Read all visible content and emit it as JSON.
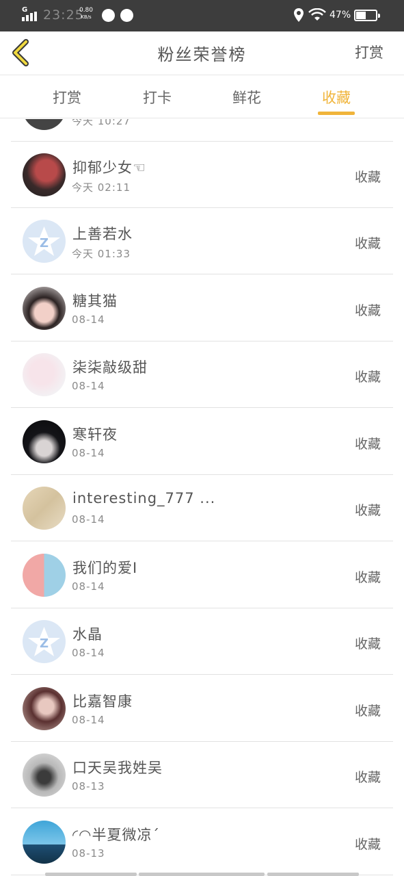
{
  "status_bar": {
    "network": "G",
    "time": "23:25",
    "speed_value": "0.80",
    "speed_unit": "KB/s",
    "battery": "47%",
    "battery_level": 0.47
  },
  "header": {
    "back_icon": "chevron-left-icon",
    "title": "粉丝荣誉榜",
    "right_action": "打赏"
  },
  "tabs": [
    {
      "label": "打赏",
      "active": false
    },
    {
      "label": "打卡",
      "active": false
    },
    {
      "label": "鲜花",
      "active": false
    },
    {
      "label": "收藏",
      "active": true
    }
  ],
  "accent_color": "#f0b43a",
  "list": {
    "partial_top_time": "今天 10:27",
    "items": [
      {
        "name": "抑郁少女☜",
        "time": "今天 02:11",
        "action": "收藏"
      },
      {
        "name": "上善若水",
        "time": "今天 01:33",
        "action": "收藏"
      },
      {
        "name": "糖其猫",
        "time": "08-14",
        "action": "收藏"
      },
      {
        "name": "柒柒敲级甜",
        "time": "08-14",
        "action": "收藏"
      },
      {
        "name": "寒轩夜",
        "time": "08-14",
        "action": "收藏"
      },
      {
        "name": "interesting_777 ...",
        "time": "08-14",
        "action": "收藏"
      },
      {
        "name": "我们的爱I",
        "time": "08-14",
        "action": "收藏"
      },
      {
        "name": "水晶",
        "time": "08-14",
        "action": "收藏"
      },
      {
        "name": "比嘉智康",
        "time": "08-14",
        "action": "收藏"
      },
      {
        "name": "口天吴我姓吴",
        "time": "08-13",
        "action": "收藏"
      },
      {
        "name": "◜◠半夏微凉ˊ",
        "time": "08-13",
        "action": "收藏"
      }
    ]
  }
}
